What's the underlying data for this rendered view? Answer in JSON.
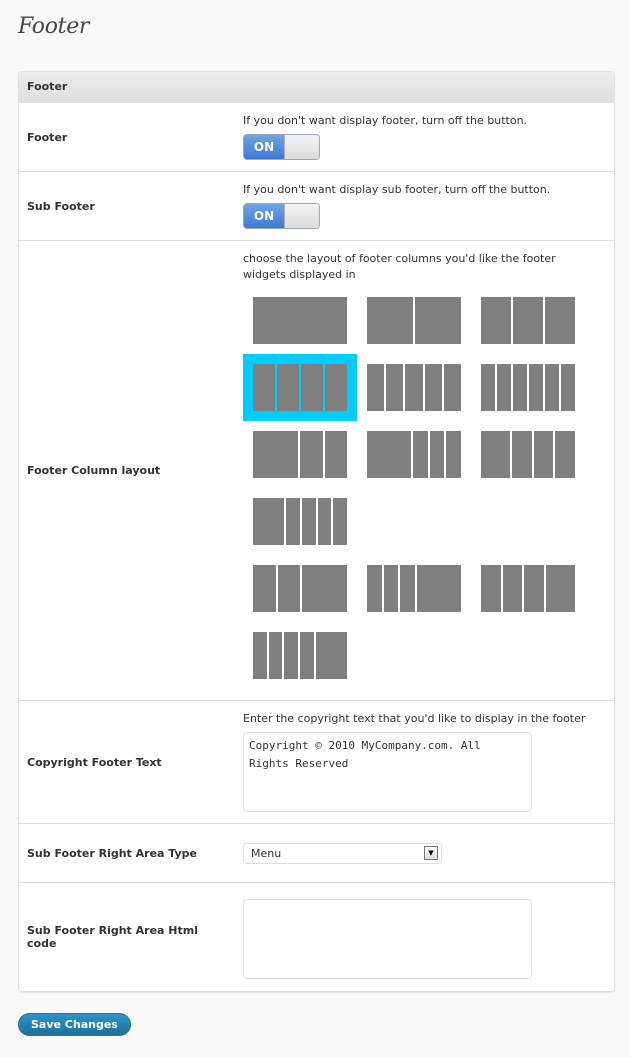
{
  "page": {
    "title": "Footer"
  },
  "panel": {
    "header": "Footer",
    "footer_toggle": {
      "label": "Footer",
      "description": "If you don't want display footer, turn off the button.",
      "state": "ON"
    },
    "sub_footer_toggle": {
      "label": "Sub Footer",
      "description": "If you don't want display sub footer, turn off the button.",
      "state": "ON"
    },
    "column_layout": {
      "label": "Footer Column layout",
      "description": "choose the layout of footer columns you'd like the footer widgets displayed in",
      "selected_index": 3,
      "options": [
        [
          1
        ],
        [
          1,
          1
        ],
        [
          1,
          1,
          1
        ],
        [
          1,
          1,
          1,
          1
        ],
        [
          1,
          1,
          1,
          1,
          1
        ],
        [
          1,
          1,
          1,
          1,
          1,
          1
        ],
        [
          2,
          1,
          1
        ],
        [
          3,
          1,
          1,
          1
        ],
        [
          3,
          2,
          2,
          2
        ],
        [
          3,
          1.3,
          1.3,
          1.3,
          1.3
        ],
        [
          1,
          1,
          2
        ],
        [
          1,
          1,
          1,
          3
        ],
        [
          2,
          2,
          2,
          3
        ],
        [
          1.3,
          1.3,
          1.3,
          1.3,
          3
        ]
      ]
    },
    "copyright": {
      "label": "Copyright Footer Text",
      "description": "Enter the copyright text that you'd like to display in the footer",
      "value": "Copyright © 2010 MyCompany.com. All Rights Reserved"
    },
    "right_area_type": {
      "label": "Sub Footer Right Area Type",
      "selected": "Menu"
    },
    "right_area_html": {
      "label": "Sub Footer Right Area Html code",
      "value": ""
    }
  },
  "actions": {
    "save_label": "Save Changes"
  },
  "colors": {
    "accent_selected": "#00ccff",
    "toggle_on": "#3d7bd4",
    "save_button": "#21759b",
    "layout_column": "#7f7f7f"
  }
}
